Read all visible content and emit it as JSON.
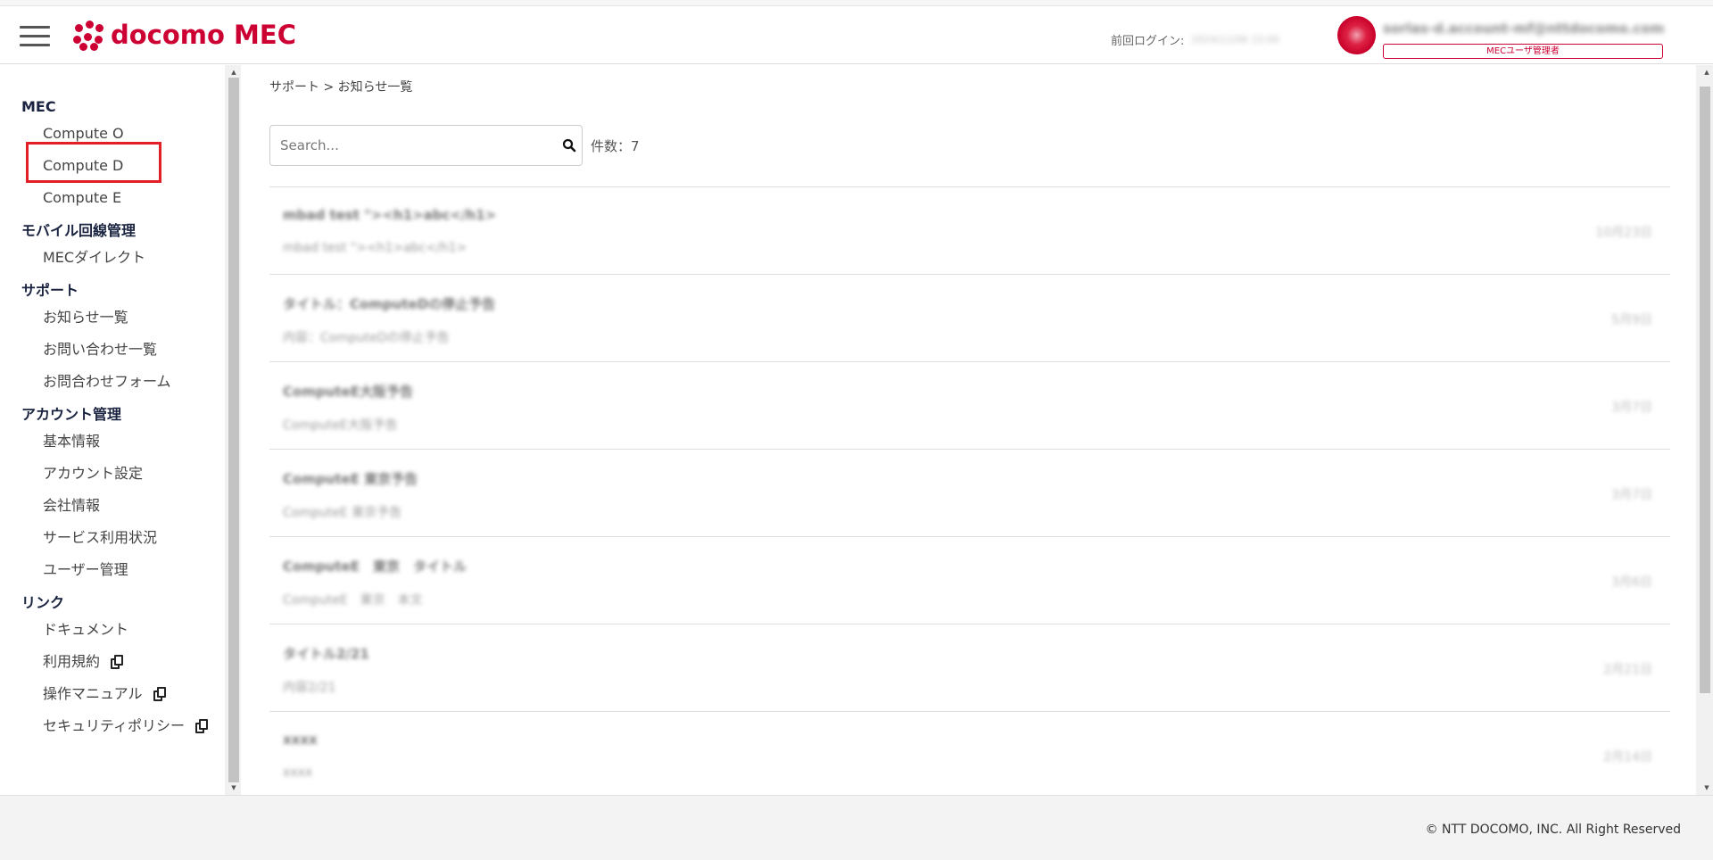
{
  "header": {
    "brand": "docomo MEC",
    "last_login_label": "前回ログイン:",
    "last_login_value": "2024/11/06 15:00",
    "user_email": "sorlas-d.account-mf@nttdocomo.com",
    "role": "MECユーザ管理者",
    "brand_color": "#cc0033"
  },
  "sidebar": {
    "sections": [
      {
        "title": "MEC",
        "items": [
          {
            "label": "Compute O"
          },
          {
            "label": "Compute D"
          },
          {
            "label": "Compute E"
          }
        ]
      },
      {
        "title": "モバイル回線管理",
        "items": [
          {
            "label": "MECダイレクト"
          }
        ]
      },
      {
        "title": "サポート",
        "items": [
          {
            "label": "お知らせ一覧"
          },
          {
            "label": "お問い合わせ一覧"
          },
          {
            "label": "お問合わせフォーム"
          }
        ]
      },
      {
        "title": "アカウント管理",
        "items": [
          {
            "label": "基本情報"
          },
          {
            "label": "アカウント設定"
          },
          {
            "label": "会社情報"
          },
          {
            "label": "サービス利用状況"
          },
          {
            "label": "ユーザー管理"
          }
        ]
      },
      {
        "title": "リンク",
        "items": [
          {
            "label": "ドキュメント"
          },
          {
            "label": "利用規約",
            "icon": "copy-icon"
          },
          {
            "label": "操作マニュアル",
            "icon": "copy-icon"
          },
          {
            "label": "セキュリティポリシー",
            "icon": "copy-icon"
          }
        ]
      }
    ],
    "highlighted_item": "Compute D",
    "highlight_color": "#e21f26"
  },
  "main": {
    "breadcrumb": "サポート > お知らせ一覧",
    "search": {
      "placeholder": "Search...",
      "value": ""
    },
    "count_label": "件数：7",
    "notices": [
      {
        "title": "mbad test \"><h1>abc</h1>",
        "body": "mbad test \"><h1>abc</h1>",
        "date": "10月23日"
      },
      {
        "title": "タイトル：ComputeDの停止予告",
        "body": "内容：ComputeDの停止予告",
        "date": "5月9日"
      },
      {
        "title": "ComputeE大阪予告",
        "body": "ComputeE大阪予告",
        "date": "3月7日"
      },
      {
        "title": "ComputeE 東京予告",
        "body": "ComputeE 東京予告",
        "date": "3月7日"
      },
      {
        "title": "ComputeE　東京　タイトル",
        "body": "ComputeE　東京　本文",
        "date": "3月6日"
      },
      {
        "title": "タイトル2/21",
        "body": "内容2/21",
        "date": "2月21日"
      },
      {
        "title": "xxxx",
        "body": "xxxx",
        "date": "2月14日"
      }
    ]
  },
  "footer": {
    "copyright": "© NTT DOCOMO, INC. All Right Reserved"
  }
}
